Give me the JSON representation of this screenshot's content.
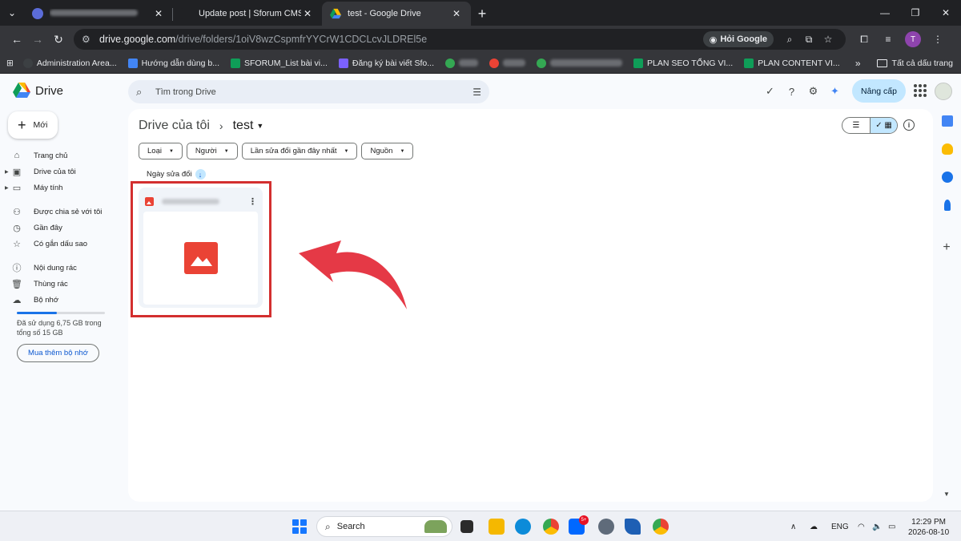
{
  "browser": {
    "tabs": [
      {
        "label": "",
        "blurred": true
      },
      {
        "label": "Update post | Sforum CMS"
      },
      {
        "label": "test - Google Drive",
        "active": true
      }
    ],
    "url_host": "drive.google.com",
    "url_path": "/drive/folders/1oiV8wzCspmfrYYCrW1CDCLcvJLDREl5e",
    "ask_google": "Hỏi Google",
    "profile_initial": "T",
    "bookmarks": [
      {
        "label": "Administration Area...",
        "color": "#3c4043"
      },
      {
        "label": "Hướng dẫn dùng b...",
        "color": "#4285f4"
      },
      {
        "label": "SFORUM_List bài vi...",
        "color": "#0f9d58"
      },
      {
        "label": "Đăng ký bài viết Sfo...",
        "color": "#7b61ff"
      },
      {
        "label": "PLAN SEO TỔNG VI...",
        "color": "#0f9d58"
      },
      {
        "label": "PLAN CONTENT VI...",
        "color": "#0f9d58"
      }
    ],
    "all_bookmarks": "Tất cả dấu trang"
  },
  "drive": {
    "app_name": "Drive",
    "search_placeholder": "Tìm trong Drive",
    "upgrade_label": "Nâng cấp",
    "new_label": "Mới",
    "nav": [
      {
        "label": "Trang chủ",
        "icon": "home-icon"
      },
      {
        "label": "Drive của tôi",
        "icon": "my-drive-icon"
      },
      {
        "label": "Máy tính",
        "icon": "computer-icon"
      },
      {
        "label": "Được chia sẻ với tôi",
        "icon": "shared-icon"
      },
      {
        "label": "Gần đây",
        "icon": "recent-icon"
      },
      {
        "label": "Có gắn dấu sao",
        "icon": "star-icon"
      },
      {
        "label": "Nội dung rác",
        "icon": "spam-icon"
      },
      {
        "label": "Thùng rác",
        "icon": "trash-icon"
      },
      {
        "label": "Bộ nhớ",
        "icon": "cloud-icon"
      }
    ],
    "storage_used_fraction": 0.45,
    "storage_text": "Đã sử dụng 6,75 GB trong tổng số 15 GB",
    "buy_storage": "Mua thêm bộ nhớ",
    "breadcrumb_root": "Drive của tôi",
    "breadcrumb_current": "test",
    "filters": [
      "Loại",
      "Người",
      "Lần sửa đổi gần đây nhất",
      "Nguồn"
    ],
    "sort_label": "Ngày sửa đổi",
    "accent": "#0b57d0",
    "highlight_color": "#d32f2f"
  },
  "taskbar": {
    "search": "Search",
    "lang": "ENG",
    "time": "12:29 PM",
    "date": "2026-08-10",
    "badge": "5+"
  }
}
